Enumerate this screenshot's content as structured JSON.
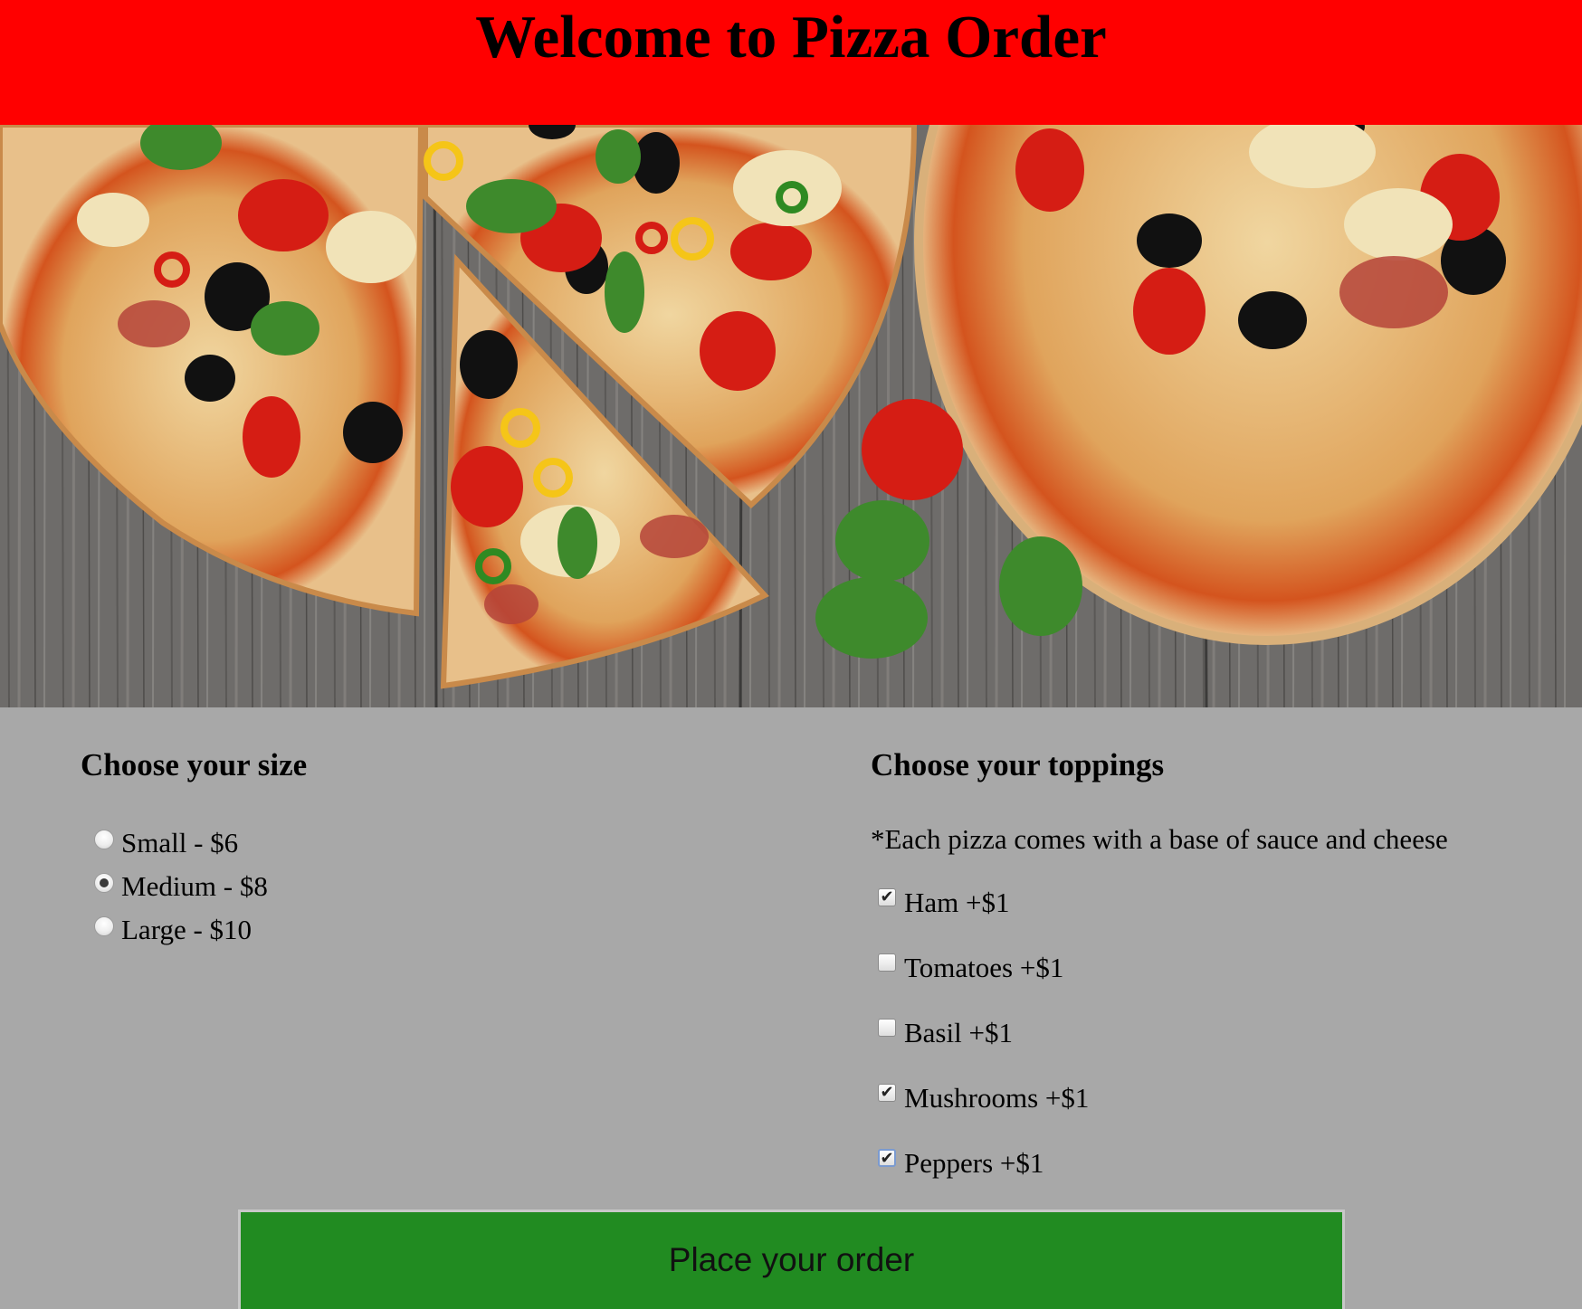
{
  "header": {
    "title": "Welcome to Pizza Order"
  },
  "hero": {
    "image": "pizza-photo",
    "colors": {
      "wood": "#6e6c6a",
      "crust": "#d9a066",
      "sauce": "#d4541e",
      "cheese": "#f1e3b8",
      "tomato": "#d51d14",
      "olive": "#111111",
      "basil": "#3e8a2c"
    }
  },
  "size_section": {
    "title": "Choose your size",
    "options": [
      {
        "label": "Small - $6",
        "checked": false
      },
      {
        "label": "Medium - $8",
        "checked": true
      },
      {
        "label": "Large - $10",
        "checked": false
      }
    ]
  },
  "toppings_section": {
    "title": "Choose your toppings",
    "note": "*Each pizza comes with a base of sauce and cheese",
    "options": [
      {
        "label": "Ham +$1",
        "checked": true
      },
      {
        "label": "Tomatoes +$1",
        "checked": false
      },
      {
        "label": "Basil +$1",
        "checked": false
      },
      {
        "label": "Mushrooms +$1",
        "checked": true
      },
      {
        "label": "Peppers +$1",
        "checked": true
      }
    ]
  },
  "order_button": {
    "label": "Place your order"
  },
  "colors": {
    "header_bg": "#ff0000",
    "page_bg": "#a8a8a8",
    "button_bg": "#218b21"
  }
}
